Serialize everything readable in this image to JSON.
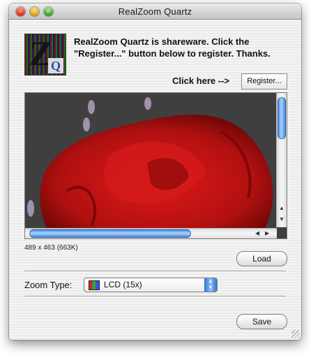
{
  "window": {
    "title": "RealZoom Quartz"
  },
  "logo": {
    "letter_z": "Z",
    "letter_q": "Q"
  },
  "message": {
    "text": "RealZoom Quartz is shareware. Click the \"Register...\" button below to register. Thanks."
  },
  "register": {
    "prompt": "Click here -->",
    "button_label": "Register..."
  },
  "image": {
    "size_info": "489 x 463 (663K)"
  },
  "buttons": {
    "load_label": "Load",
    "save_label": "Save"
  },
  "zoom": {
    "label": "Zoom Type:",
    "selected": "LCD (15x)"
  },
  "scroll": {
    "vertical_position": 0.0,
    "horizontal_position": 0.0
  },
  "colors": {
    "accent": "#3a7fd6",
    "rose": "#c01414"
  }
}
